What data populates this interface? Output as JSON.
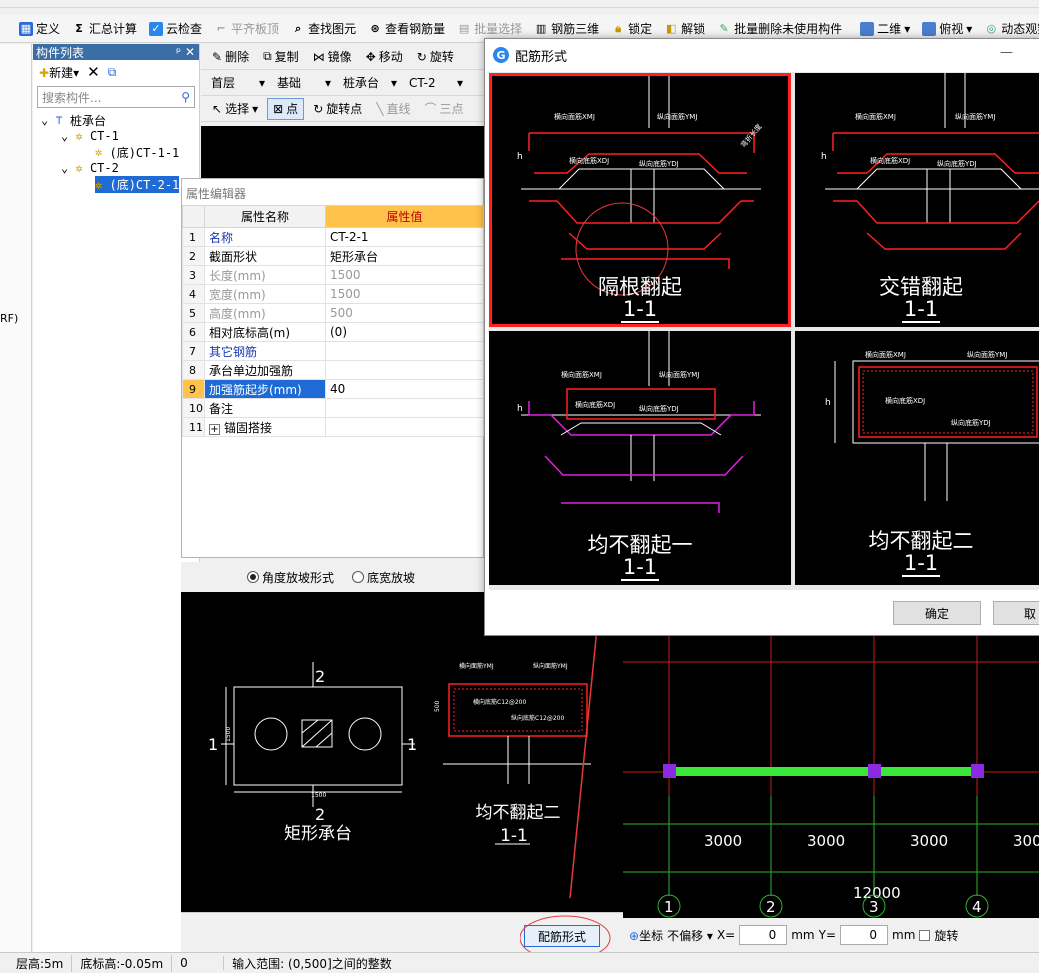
{
  "toolbar": {
    "define": "定义",
    "sum_calc": "汇总计算",
    "cloud_check": "云检查",
    "flat_slab": "平齐板顶",
    "find_elem": "查找图元",
    "view_rebar_qty": "查看钢筋量",
    "batch_select": "批量选择",
    "rebar_3d": "钢筋三维",
    "lock": "锁定",
    "unlock": "解锁",
    "batch_delete": "批量删除未使用构件",
    "view_2d": "二维",
    "view_top": "俯视",
    "dynamic_view": "动态观察"
  },
  "left_strip": {
    "text": "RF)"
  },
  "component_panel": {
    "title": "构件列表",
    "pin": "ᵖ",
    "close": "✕",
    "new_label": "新建",
    "search_placeholder": "搜索构件...",
    "tree": {
      "root": "桩承台",
      "items": [
        "CT-1",
        "(底)CT-1-1",
        "CT-2",
        "(底)CT-2-1"
      ]
    }
  },
  "cad_toolbar": {
    "delete": "删除",
    "copy": "复制",
    "mirror": "镜像",
    "move": "移动",
    "rotate": "旋转",
    "floor": "首层",
    "category": "基础",
    "type": "桩承台",
    "element": "CT-2",
    "select": "选择",
    "point": "点",
    "rotate_point": "旋转点",
    "line": "直线",
    "three_point": "三点"
  },
  "property_editor": {
    "title": "属性编辑器",
    "col_name": "属性名称",
    "col_value": "属性值",
    "rows": [
      {
        "idx": "1",
        "name": "名称",
        "value": "CT-2-1"
      },
      {
        "idx": "2",
        "name": "截面形状",
        "value": "矩形承台"
      },
      {
        "idx": "3",
        "name": "长度(mm)",
        "value": "1500"
      },
      {
        "idx": "4",
        "name": "宽度(mm)",
        "value": "1500"
      },
      {
        "idx": "5",
        "name": "高度(mm)",
        "value": "500"
      },
      {
        "idx": "6",
        "name": "相对底标高(m)",
        "value": "(0)"
      },
      {
        "idx": "7",
        "name": "其它钢筋",
        "value": ""
      },
      {
        "idx": "8",
        "name": "承台单边加强筋",
        "value": ""
      },
      {
        "idx": "9",
        "name": "加强筋起步(mm)",
        "value": "40"
      },
      {
        "idx": "10",
        "name": "备注",
        "value": ""
      },
      {
        "idx": "11",
        "name": "锚固搭接",
        "value": ""
      }
    ],
    "expand_symbol": "+"
  },
  "slope_options": {
    "angle": "角度放坡形式",
    "bottom_width": "底宽放坡"
  },
  "preview": {
    "plan_title": "矩形承台",
    "section_title": "均不翻起二",
    "section_sub": "1-1",
    "section_marks": [
      "1",
      "1",
      "2",
      "2"
    ],
    "plan_dims": [
      "1500",
      "1500"
    ],
    "section_labels": [
      "横向面筋YMJ",
      "纵向面筋YMJ",
      "横向底筋C12@200",
      "纵向底筋C12@200",
      "500"
    ]
  },
  "cad_main": {
    "spans": [
      "3000",
      "3000",
      "3000",
      "300"
    ],
    "total": "12000",
    "axes": [
      "1",
      "2",
      "3",
      "4"
    ]
  },
  "bottom": {
    "peijin_button": "配筋形式"
  },
  "coord_bar": {
    "coord": "坐标",
    "no_offset": "不偏移",
    "x_label": "X=",
    "x_value": "0",
    "unit_mm": "mm",
    "y_label": "Y=",
    "y_value": "0",
    "rotate": "旋转"
  },
  "status": {
    "floor_height": "层高:5m",
    "bottom_elev": "底标高:-0.05m",
    "zero": "0",
    "hint": "输入范围: (0,500]之间的整数"
  },
  "dialog": {
    "title": "配筋形式",
    "ok": "确定",
    "cancel": "取",
    "options": [
      {
        "title": "隔根翻起",
        "sub": "1-1"
      },
      {
        "title": "交错翻起",
        "sub": "1-1"
      },
      {
        "title": "均不翻起一",
        "sub": "1-1"
      },
      {
        "title": "均不翻起二",
        "sub": "1-1"
      }
    ],
    "labels": {
      "top_h": "横向面筋XMJ",
      "top_v": "纵向面筋YMJ",
      "bot_h": "横向底筋XDJ",
      "bot_v": "纵向底筋YDJ",
      "bend": "弯折长度",
      "h": "h"
    }
  },
  "colors": {
    "accent": "#1e6bd6",
    "header_orange": "#ffc24a",
    "rebar_red": "#ff2020",
    "rebar_magenta": "#e020e0",
    "beam_green": "#39e639",
    "node_purple": "#8a2be2"
  }
}
